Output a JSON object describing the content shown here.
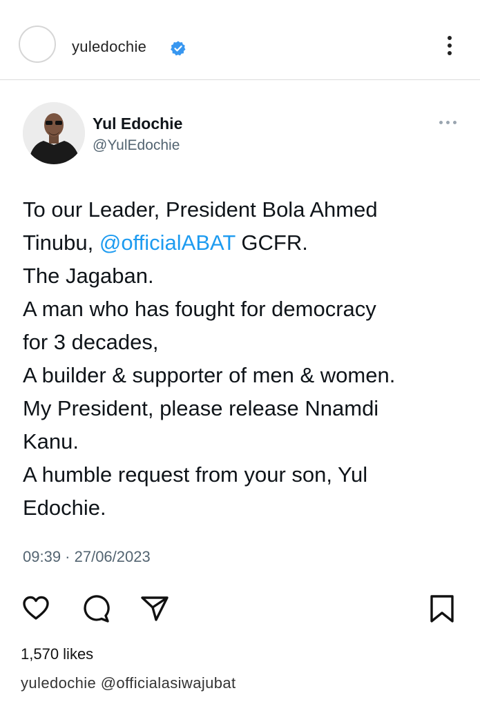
{
  "header": {
    "username": "yuledochie",
    "icons": {
      "verified": "verified-badge-icon",
      "menu": "more-vertical-icon"
    },
    "badge_color": "#3897f0"
  },
  "tweet": {
    "display_name": "Yul Edochie",
    "handle": "@YulEdochie",
    "more_icon": "more-horizontal-icon",
    "lines": [
      {
        "text": "To our Leader, President Bola Ahmed"
      },
      {
        "prefix": "Tinubu, ",
        "mention": "@officialABAT",
        "suffix": " GCFR."
      },
      {
        "text": "The Jagaban."
      },
      {
        "text": "A man who has fought for democracy"
      },
      {
        "text": "for 3 decades,"
      },
      {
        "text": "A builder & supporter of men & women."
      },
      {
        "text": "My President, please release Nnamdi"
      },
      {
        "text": "Kanu."
      },
      {
        "text": "A humble request from your son, Yul"
      },
      {
        "text": "Edochie."
      }
    ],
    "timestamp": "09:39 · 27/06/2023",
    "mention_color": "#1d9bf0"
  },
  "post": {
    "actions": [
      "like-heart-icon",
      "comment-bubble-icon",
      "share-send-icon",
      "save-bookmark-icon"
    ],
    "likes": "1,570 likes",
    "caption": "yuledochie @officialasiwajubat"
  }
}
